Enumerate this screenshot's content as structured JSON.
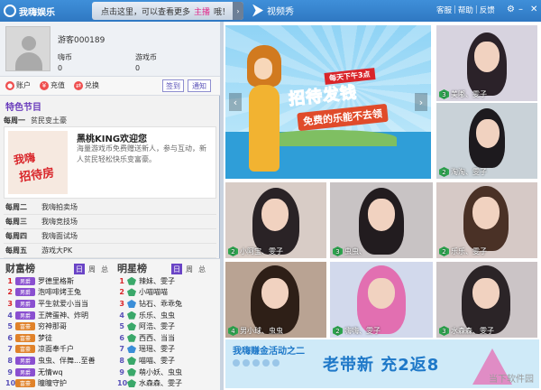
{
  "app": {
    "logo_text": "我嗨娱乐",
    "promo_prefix": "点击这里，可以查看更多",
    "promo_highlight": "主播",
    "promo_suffix": "哦！",
    "promo_arrow": "›",
    "video_show": "视频秀",
    "menu": [
      "客服",
      "帮助",
      "反馈"
    ],
    "menu_sep": "|",
    "window_controls": [
      "⚙",
      "–",
      "✕"
    ]
  },
  "profile": {
    "username": "游客000189",
    "coins_label": "嗨币",
    "coins_value": "0",
    "game_coins_label": "游戏币",
    "game_coins_value": "0"
  },
  "actions": {
    "account": "账户",
    "recharge": "充值",
    "exchange": "兑换",
    "signin": "签到",
    "notice": "通知"
  },
  "feature": {
    "section_title": "特色节目",
    "day": "每周一",
    "name": "贫民变土豪",
    "img_line1": "我嗨",
    "img_line2": "招待房",
    "title": "黑桃KING欢迎您",
    "desc": "海量游戏币免费赠送新人，参与互动，新人贫民轻松快乐变富豪。"
  },
  "schedule": [
    {
      "day": "每周二",
      "name": "我嗨拍卖场"
    },
    {
      "day": "每周三",
      "name": "我嗨竞技场"
    },
    {
      "day": "每周四",
      "name": "我嗨面试场"
    },
    {
      "day": "每周五",
      "name": "游戏大PK"
    }
  ],
  "wealth": {
    "title": "财富榜",
    "tabs": [
      "日",
      "周",
      "总"
    ],
    "rows": [
      {
        "no": "1",
        "badge": "男爵",
        "name": "罗德里格斯"
      },
      {
        "no": "2",
        "badge": "男爵",
        "name": "泡啡啡烤王兔"
      },
      {
        "no": "3",
        "badge": "男爵",
        "name": "平生就爱小当当"
      },
      {
        "no": "4",
        "badge": "男爵",
        "name": "王牌蛋神、炸明"
      },
      {
        "no": "5",
        "badge": "富豪",
        "name": "穷神那哥"
      },
      {
        "no": "6",
        "badge": "富豪",
        "name": "梦徒"
      },
      {
        "no": "7",
        "badge": "富豪",
        "name": "凉面奉千户"
      },
      {
        "no": "8",
        "badge": "男爵",
        "name": "虫虫、伴舞...至善"
      },
      {
        "no": "9",
        "badge": "男爵",
        "name": "无情wq"
      },
      {
        "no": "10",
        "badge": "富豪",
        "name": "瞳瞳守护"
      }
    ]
  },
  "stars": {
    "title": "明星榜",
    "tabs": [
      "日",
      "周",
      "总"
    ],
    "rows": [
      {
        "no": "1",
        "name": "辣妹、雯子"
      },
      {
        "no": "2",
        "name": "小喵喵喵"
      },
      {
        "no": "3",
        "name": "钻石、乖乖兔"
      },
      {
        "no": "4",
        "name": "乐乐、虫虫"
      },
      {
        "no": "5",
        "name": "阿浩、雯子"
      },
      {
        "no": "6",
        "name": "西西、当当"
      },
      {
        "no": "7",
        "name": "瑶瑶、雯子"
      },
      {
        "no": "8",
        "name": "喵喵、雯子"
      },
      {
        "no": "9",
        "name": "萌小妖、虫虫"
      },
      {
        "no": "10",
        "name": "水森森、雯子"
      }
    ]
  },
  "banner": {
    "sub": "每天下午3点",
    "main": "招待发钱",
    "tag": "免费的乐能不去领",
    "prev": "‹",
    "next": "›"
  },
  "anchors": [
    {
      "lvl": "3",
      "name": "美嘟、雯子"
    },
    {
      "lvl": "2",
      "name": "淘淘、雯子"
    },
    {
      "lvl": "2",
      "name": "小阿宝、雯子"
    },
    {
      "lvl": "3",
      "name": "虫虫、"
    },
    {
      "lvl": "2",
      "name": "乐乐、雯子"
    },
    {
      "lvl": "4",
      "name": "男小球、虫虫"
    },
    {
      "lvl": "2",
      "name": "嗨嗨、雯子"
    },
    {
      "lvl": "3",
      "name": "水森森、雯子"
    }
  ],
  "bottom_banner": {
    "text1": "我嗨赚金活动之二",
    "text2": "老带新 充2返8",
    "watermark": "当下软件园"
  }
}
